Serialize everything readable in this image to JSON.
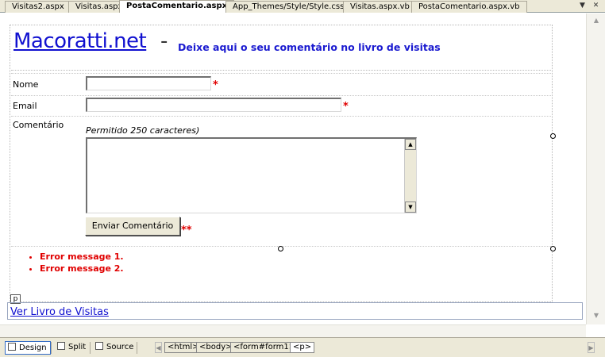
{
  "tabs": [
    {
      "label": "Visitas2.aspx"
    },
    {
      "label": "Visitas.aspx"
    },
    {
      "label": "PostaComentario.aspx"
    },
    {
      "label": "App_Themes/Style/Style.css"
    },
    {
      "label": "Visitas.aspx.vb"
    },
    {
      "label": "PostaComentario.aspx.vb"
    }
  ],
  "tab_controls": {
    "dropdown": "▼",
    "close": "✕"
  },
  "header": {
    "logo": "Macoratti.net",
    "dash": "-",
    "tagline": "Deixe aqui o seu comentário no livro de visitas"
  },
  "form": {
    "name_label": "Nome",
    "email_label": "Email",
    "comment_label": "Comentário",
    "required_mark": "*",
    "hint": "Permitido 250 caracteres)",
    "submit_label": "Enviar Comentário",
    "submit_required_mark": "**",
    "name_value": "",
    "email_value": "",
    "comment_value": ""
  },
  "errors": [
    "Error message 1.",
    "Error message 2."
  ],
  "p_tag": "p",
  "link_label": "Ver Livro de Visitas",
  "view_buttons": {
    "design": "Design",
    "split": "Split",
    "source": "Source"
  },
  "breadcrumb": [
    "<html>",
    "<body>",
    "<form#form1>",
    "<p>"
  ],
  "colors": {
    "logo": "#1010d0",
    "error": "#e00000",
    "chrome": "#ece9d8"
  }
}
